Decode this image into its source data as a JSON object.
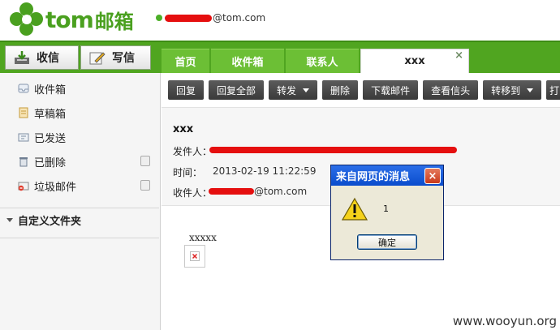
{
  "brand": {
    "en": "tom",
    "cn": "邮箱"
  },
  "account": {
    "email_suffix": "@tom.com"
  },
  "commands": {
    "inbox": "收信",
    "compose": "写信"
  },
  "nav_tabs": [
    {
      "label": "首页"
    },
    {
      "label": "收件箱"
    },
    {
      "label": "联系人"
    },
    {
      "label": "xxx",
      "close": "×"
    }
  ],
  "folders": [
    {
      "label": "收件箱",
      "icon": "inbox-icon"
    },
    {
      "label": "草稿箱",
      "icon": "drafts-icon"
    },
    {
      "label": "已发送",
      "icon": "sent-icon"
    },
    {
      "label": "已删除",
      "icon": "deleted-icon"
    },
    {
      "label": "垃圾邮件",
      "icon": "spam-icon"
    }
  ],
  "custom_folders": "自定义文件夹",
  "toolbar": [
    "回复",
    "回复全部",
    "转发",
    "删除",
    "下载邮件",
    "查看信头",
    "转移到",
    "打"
  ],
  "message": {
    "subject": "xxx",
    "from_label": "发件人：",
    "time_label": "时间：",
    "time_value": "2013-02-19 11:22:59",
    "to_label": "收件人：",
    "to_suffix": "@tom.com",
    "body_text": "xxxxx"
  },
  "dialog": {
    "title": "来自网页的消息",
    "message": "1",
    "ok": "确定",
    "close": "×"
  },
  "watermark": "www.wooyun.org",
  "colors": {
    "brand_green": "#4aa01f",
    "nav_green": "#50a520",
    "redaction": "#e50f0f",
    "dialog_blue": "#0a4ccc"
  }
}
